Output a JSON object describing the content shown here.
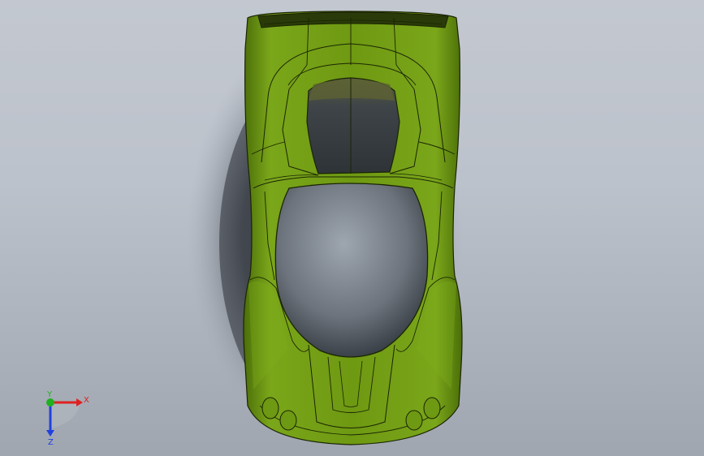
{
  "viewport": {
    "background_top": "#c3c8d0",
    "background_bottom": "#9fa6b0",
    "model_color": "#6f9a12",
    "model_highlight": "#8fbb25",
    "model_shadow": "#3f5c06",
    "edge_color": "#1b2404"
  },
  "triad": {
    "x_label": "X",
    "y_label": "Y",
    "z_label": "Z",
    "x_color": "#e02020",
    "y_color": "#20b020",
    "z_color": "#2040e0"
  }
}
